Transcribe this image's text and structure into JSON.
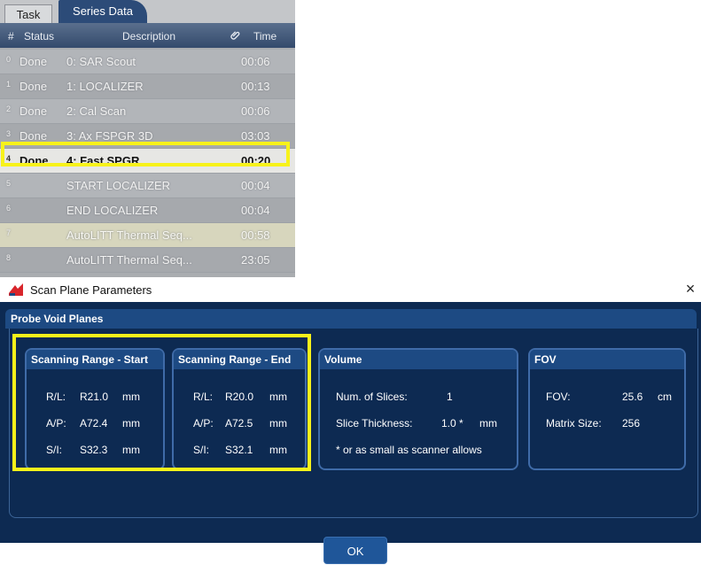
{
  "task_list": {
    "tabs": [
      "Task",
      "Series Data"
    ],
    "columns": {
      "num": "#",
      "status": "Status",
      "description": "Description",
      "time": "Time"
    },
    "rows": [
      {
        "num": "0",
        "status": "Done",
        "description": "0: SAR Scout",
        "time": "00:06"
      },
      {
        "num": "1",
        "status": "Done",
        "description": "1: LOCALIZER",
        "time": "00:13"
      },
      {
        "num": "2",
        "status": "Done",
        "description": "2: Cal Scan",
        "time": "00:06"
      },
      {
        "num": "3",
        "status": "Done",
        "description": "3: Ax FSPGR 3D",
        "time": "03:03"
      },
      {
        "num": "4",
        "status": "Done",
        "description": "4: Fast SPGR",
        "time": "00:20"
      },
      {
        "num": "5",
        "status": "",
        "description": "START LOCALIZER",
        "time": "00:04"
      },
      {
        "num": "6",
        "status": "",
        "description": "END LOCALIZER",
        "time": "00:04"
      },
      {
        "num": "7",
        "status": "",
        "description": "AutoLITT Thermal Seq...",
        "time": "00:58"
      },
      {
        "num": "8",
        "status": "",
        "description": "AutoLITT Thermal Seq...",
        "time": "23:05"
      }
    ],
    "selected_row": 4,
    "icons": {
      "attachment": "paperclip-icon"
    },
    "colors": {
      "highlight": "#f7f21a"
    }
  },
  "dialog": {
    "title": "Scan Plane Parameters",
    "close_glyph": "×",
    "section_title": "Probe Void Planes",
    "start": {
      "title": "Scanning Range - Start",
      "rl_label": "R/L:",
      "rl_value": "R21.0",
      "ap_label": "A/P:",
      "ap_value": "A72.4",
      "si_label": "S/I:",
      "si_value": "S32.3",
      "unit": "mm"
    },
    "end": {
      "title": "Scanning Range - End",
      "rl_label": "R/L:",
      "rl_value": "R20.0",
      "ap_label": "A/P:",
      "ap_value": "A72.5",
      "si_label": "S/I:",
      "si_value": "S32.1",
      "unit": "mm"
    },
    "volume": {
      "title": "Volume",
      "slices_label": "Num. of Slices:",
      "slices_value": "1",
      "thickness_label": "Slice Thickness:",
      "thickness_value": "1.0 *",
      "thickness_unit": "mm",
      "note": "* or as small as scanner allows"
    },
    "fov": {
      "title": "FOV",
      "fov_label": "FOV:",
      "fov_value": "25.6",
      "fov_unit": "cm",
      "matrix_label": "Matrix Size:",
      "matrix_value": "256"
    },
    "ok_label": "OK",
    "colors": {
      "background": "#0d2a52",
      "header": "#1d4a83",
      "border": "#3f6ba8"
    }
  }
}
